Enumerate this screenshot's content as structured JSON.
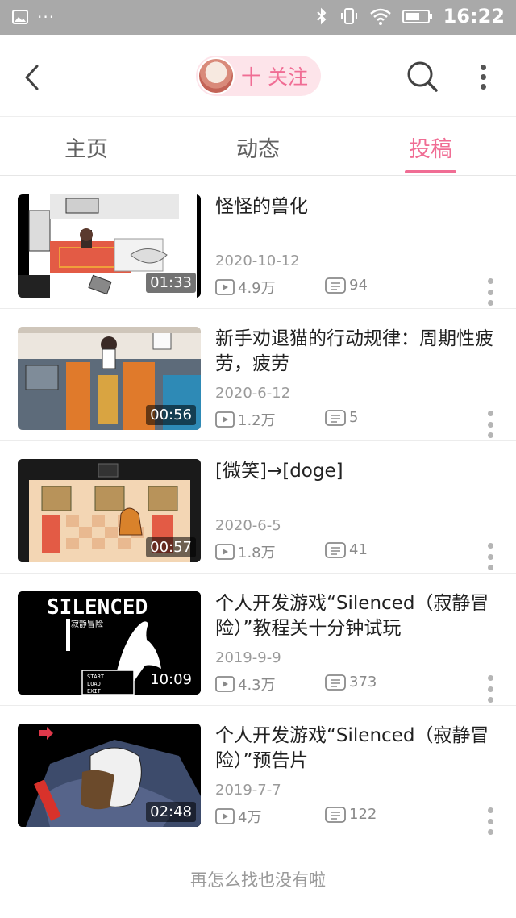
{
  "status_bar": {
    "time": "16:22",
    "dots": "···"
  },
  "header": {
    "follow_label": "十 关注"
  },
  "tabs": [
    {
      "label": "主页",
      "active": false
    },
    {
      "label": "动态",
      "active": false
    },
    {
      "label": "投稿",
      "active": true
    }
  ],
  "videos": [
    {
      "title": "怪怪的兽化",
      "date": "2020-10-12",
      "views": "4.9万",
      "comments": "94",
      "duration": "01:33"
    },
    {
      "title": "新手劝退猫的行动规律：周期性疲劳，疲劳",
      "date": "2020-6-12",
      "views": "1.2万",
      "comments": "5",
      "duration": "00:56"
    },
    {
      "title": "[微笑]→[doge]",
      "date": "2020-6-5",
      "views": "1.8万",
      "comments": "41",
      "duration": "00:57"
    },
    {
      "title": "个人开发游戏“Silenced（寂静冒险）”教程关十分钟试玩",
      "date": "2019-9-9",
      "views": "4.3万",
      "comments": "373",
      "duration": "10:09"
    },
    {
      "title": "个人开发游戏“Silenced（寂静冒险）”预告片",
      "date": "2019-7-7",
      "views": "4万",
      "comments": "122",
      "duration": "02:48"
    }
  ],
  "thumb_text": {
    "silenced_logo": "SILENCED",
    "silenced_sub": "寂静冒险",
    "menu": [
      "START",
      "LOAD",
      "EXIT"
    ]
  },
  "footer": {
    "message": "再怎么找也没有啦"
  },
  "colors": {
    "accent": "#f06d94",
    "status_bar": "#a9a9a9",
    "pill_bg": "#fde4ea"
  }
}
